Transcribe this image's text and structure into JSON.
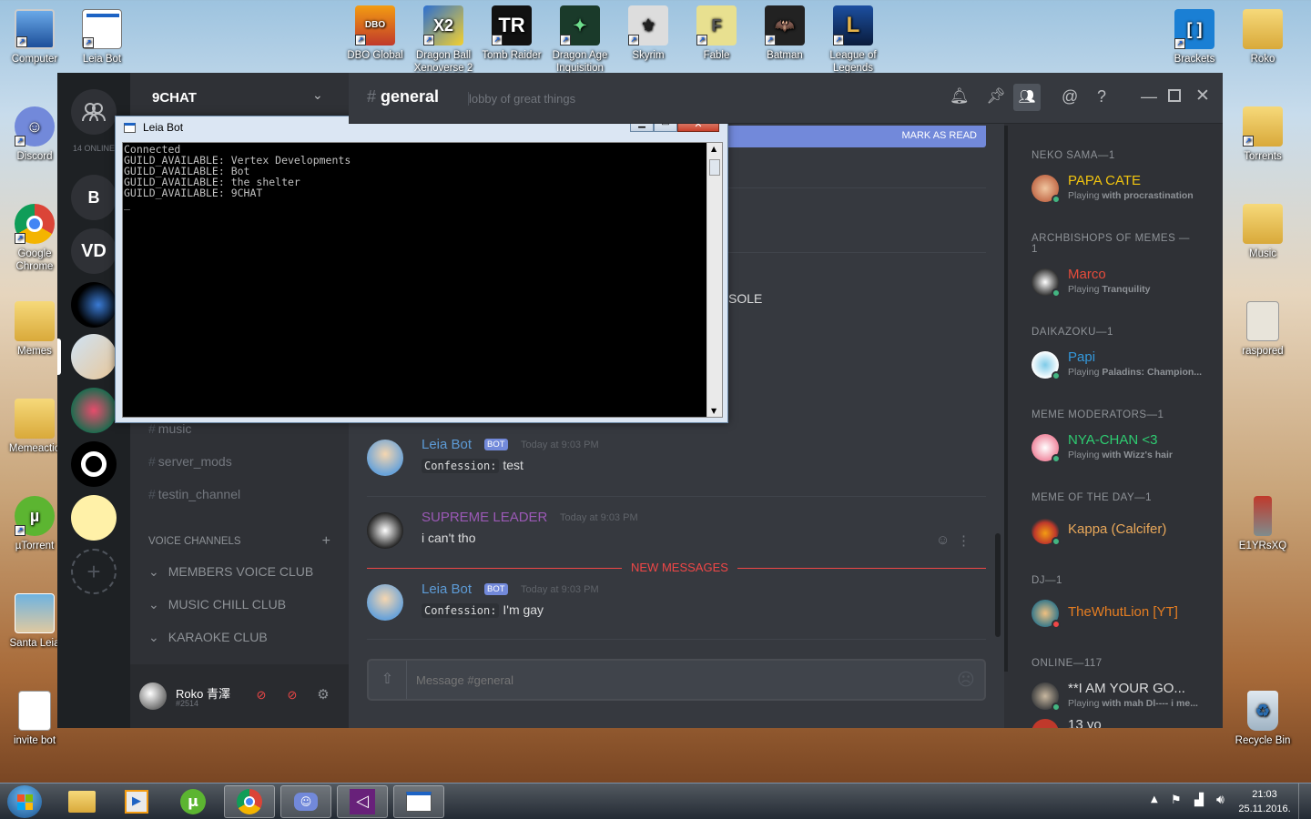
{
  "desktop_icons_left": [
    {
      "label": "Computer"
    },
    {
      "label": "Leia Bot"
    },
    {
      "label": "Discord"
    },
    {
      "label": "Google Chrome"
    },
    {
      "label": "Memes"
    },
    {
      "label": "Memeactio"
    },
    {
      "label": "µTorrent"
    },
    {
      "label": "Santa Leia"
    },
    {
      "label": "invite bot"
    }
  ],
  "desktop_icons_top": [
    {
      "label": "DBO Global"
    },
    {
      "label": "Dragon Ball Xenoverse 2"
    },
    {
      "label": "Tomb Raider"
    },
    {
      "label": "Dragon Age Inquisition"
    },
    {
      "label": "Skyrim"
    },
    {
      "label": "Fable"
    },
    {
      "label": "Batman"
    },
    {
      "label": "League of Legends"
    }
  ],
  "desktop_icons_right": [
    {
      "label": "Brackets"
    },
    {
      "label": "Roko"
    },
    {
      "label": "Torrents"
    },
    {
      "label": "Music"
    },
    {
      "label": "raspored"
    },
    {
      "label": "E1YRsXQ"
    },
    {
      "label": "Recycle Bin"
    }
  ],
  "server": {
    "name": "9CHAT",
    "online_count": "14 ONLINE",
    "guild_initials": [
      "B",
      "VD"
    ]
  },
  "channels": {
    "text": [
      "music",
      "server_mods",
      "testin_channel"
    ],
    "voice_header": "VOICE CHANNELS",
    "voice": [
      "MEMBERS VOICE CLUB",
      "MUSIC CHILL CLUB",
      "KARAOKE CLUB"
    ]
  },
  "user_panel": {
    "name": "Roko 青澤",
    "tag": "#2514"
  },
  "chat": {
    "channel_hash": "#",
    "channel_name": "general",
    "topic": "lobby of great things",
    "mark_as_read": "MARK AS READ",
    "console_word": "SOLE",
    "new_messages": "NEW MESSAGES",
    "input_placeholder": "Message #general",
    "messages": [
      {
        "user": "Leia Bot",
        "bot": "BOT",
        "time": "Today at 9:03 PM",
        "code": "Confession:",
        "text": "test",
        "color": "#5d9bd6"
      },
      {
        "user": "SUPREME LEADER",
        "bot": "",
        "time": "Today at 9:03 PM",
        "code": "",
        "text": "i can't tho",
        "color": "#9b59b6"
      },
      {
        "user": "Leia Bot",
        "bot": "BOT",
        "time": "Today at 9:03 PM",
        "code": "Confession:",
        "text": "I'm gay",
        "color": "#5d9bd6"
      }
    ]
  },
  "members": {
    "groups": [
      {
        "header": "NEKO SAMA—1",
        "name": "PAPA CATE",
        "playing_prefix": "Playing ",
        "game": "with procrastination",
        "color": "#f1c40f",
        "status": "#43b581"
      },
      {
        "header": "ARCHBISHOPS OF MEMES —1",
        "name": "Marco",
        "playing_prefix": "Playing ",
        "game": "Tranquility",
        "color": "#e74c3c",
        "status": "#43b581"
      },
      {
        "header": "DAIKAZOKU—1",
        "name": "Papi",
        "playing_prefix": "Playing ",
        "game": "Paladins: Champion...",
        "color": "#3498db",
        "status": "#43b581"
      },
      {
        "header": "MEME MODERATORS—1",
        "name": "NYA-CHAN <3",
        "playing_prefix": "Playing ",
        "game": "with Wizz's hair",
        "color": "#2ecc71",
        "status": "#43b581"
      },
      {
        "header": "MEME OF THE DAY—1",
        "name": "Kappa (Calcifer)",
        "playing_prefix": "",
        "game": "",
        "color": "#e9a85a",
        "status": "#43b581"
      },
      {
        "header": "DJ—1",
        "name": "TheWhutLion [YT]",
        "playing_prefix": "",
        "game": "",
        "color": "#e67e22",
        "status": "#f04747"
      },
      {
        "header": "ONLINE—117",
        "name": "**I AM YOUR GO...",
        "playing_prefix": "Playing ",
        "game": "with mah Dl---- i me...",
        "color": "#dcddde",
        "status": "#43b581"
      }
    ],
    "partial_name": "13 yo"
  },
  "console": {
    "title": "Leia Bot",
    "lines": [
      "Connected",
      "GUILD_AVAILABLE: Vertex Developments",
      "GUILD_AVAILABLE: Bot",
      "GUILD_AVAILABLE: the shelter",
      "GUILD_AVAILABLE: 9CHAT"
    ]
  },
  "taskbar": {
    "time": "21:03",
    "date": "25.11.2016."
  },
  "colors": {
    "blurple": "#7289da",
    "new_messages": "#f04747"
  }
}
